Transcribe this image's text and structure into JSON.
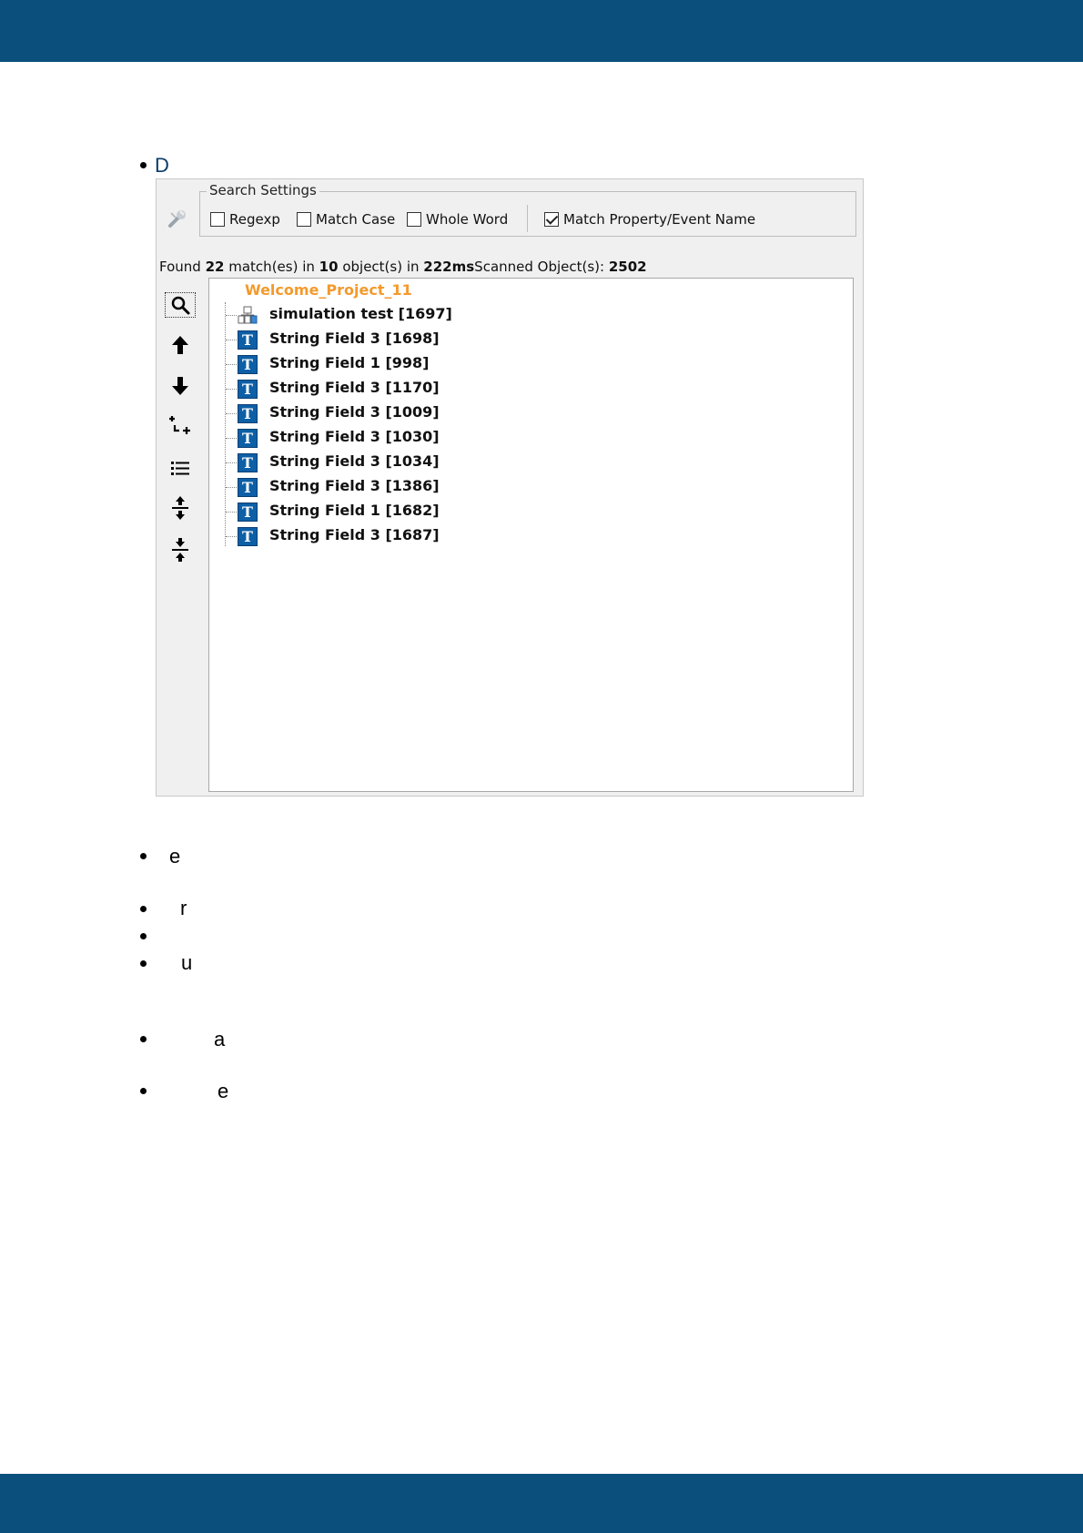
{
  "bullets": [
    {
      "text": "D"
    },
    {
      "text": "e"
    },
    {
      "text": "r"
    },
    {
      "text": ""
    },
    {
      "text": "u"
    },
    {
      "text": "a"
    },
    {
      "text": "e"
    }
  ],
  "search_panel": {
    "settings_title": "Search Settings",
    "options": [
      {
        "label": "Regexp",
        "checked": false
      },
      {
        "label": "Match Case",
        "checked": false
      },
      {
        "label": "Whole Word",
        "checked": false
      },
      {
        "label": "Match Property/Event Name",
        "checked": true
      }
    ],
    "status": {
      "found_label": "Found",
      "match_count": "22",
      "matches_label": "match(es) in",
      "object_count": "10",
      "objects_label": "object(s) in",
      "time": "222ms",
      "scanned_label": "Scanned Object(s):",
      "scanned_count": "2502"
    },
    "side_icons": [
      "search-icon",
      "arrow-up-icon",
      "arrow-down-icon",
      "add-node-icon",
      "list-icon",
      "expand-icon",
      "collapse-icon"
    ],
    "tree": {
      "root": "Welcome_Project_11",
      "root_color": "#f39a2c",
      "items": [
        {
          "label": "simulation test [1697]",
          "icon": "simulation-icon"
        },
        {
          "label": "String Field 3 [1698]",
          "icon": "text-field-icon"
        },
        {
          "label": "String Field 1 [998]",
          "icon": "text-field-icon"
        },
        {
          "label": "String Field 3 [1170]",
          "icon": "text-field-icon"
        },
        {
          "label": "String Field 3 [1009]",
          "icon": "text-field-icon"
        },
        {
          "label": "String Field 3 [1030]",
          "icon": "text-field-icon"
        },
        {
          "label": "String Field 3 [1034]",
          "icon": "text-field-icon"
        },
        {
          "label": "String Field 3 [1386]",
          "icon": "text-field-icon"
        },
        {
          "label": "String Field 1 [1682]",
          "icon": "text-field-icon"
        },
        {
          "label": "String Field 3 [1687]",
          "icon": "text-field-icon"
        }
      ],
      "text_icon_glyph": "T"
    }
  },
  "colors": {
    "header_band": "#0b4f7c",
    "text_icon_bg": "#0d5fa6"
  }
}
